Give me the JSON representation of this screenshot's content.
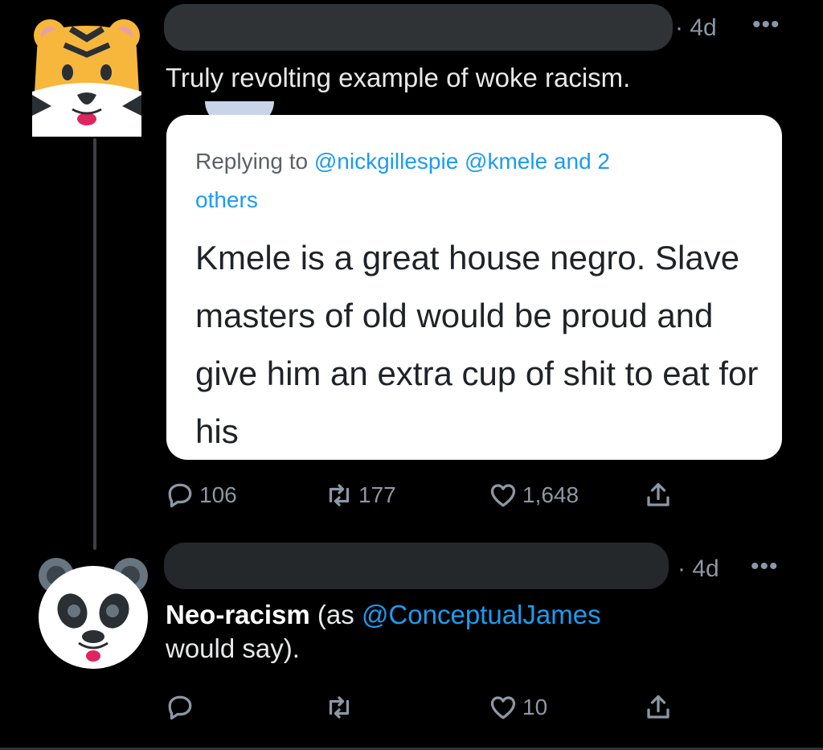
{
  "tweets": [
    {
      "avatar": "tiger-face-emoji",
      "time": "· 4d",
      "more": "•••",
      "text": "Truly revolting example of woke racism.",
      "quoted_screenshot": {
        "reply_prefix": "Replying to ",
        "reply_mentions": "@nickgillespie @kmele",
        "reply_and": " and 2",
        "reply_others": "others",
        "body": "Kmele is a great house negro. Slave masters of old would be proud and give him an extra cup of shit to eat for his"
      },
      "actions": {
        "replies": "106",
        "retweets": "177",
        "likes": "1,648"
      }
    },
    {
      "avatar": "panda-face-emoji",
      "time": "· 4d",
      "more": "•••",
      "text_bold": "Neo-racism",
      "text_pre": " (as ",
      "text_mention": "@ConceptualJames",
      "text_post": "would say).",
      "actions": {
        "replies": "",
        "retweets": "",
        "likes": "10"
      }
    }
  ],
  "icons": {
    "reply": "reply-icon",
    "retweet": "retweet-icon",
    "like": "heart-icon",
    "share": "share-icon"
  },
  "colors": {
    "background": "#000000",
    "link": "#1d9bf0",
    "muted": "#8b98a5",
    "card": "#ffffff"
  }
}
